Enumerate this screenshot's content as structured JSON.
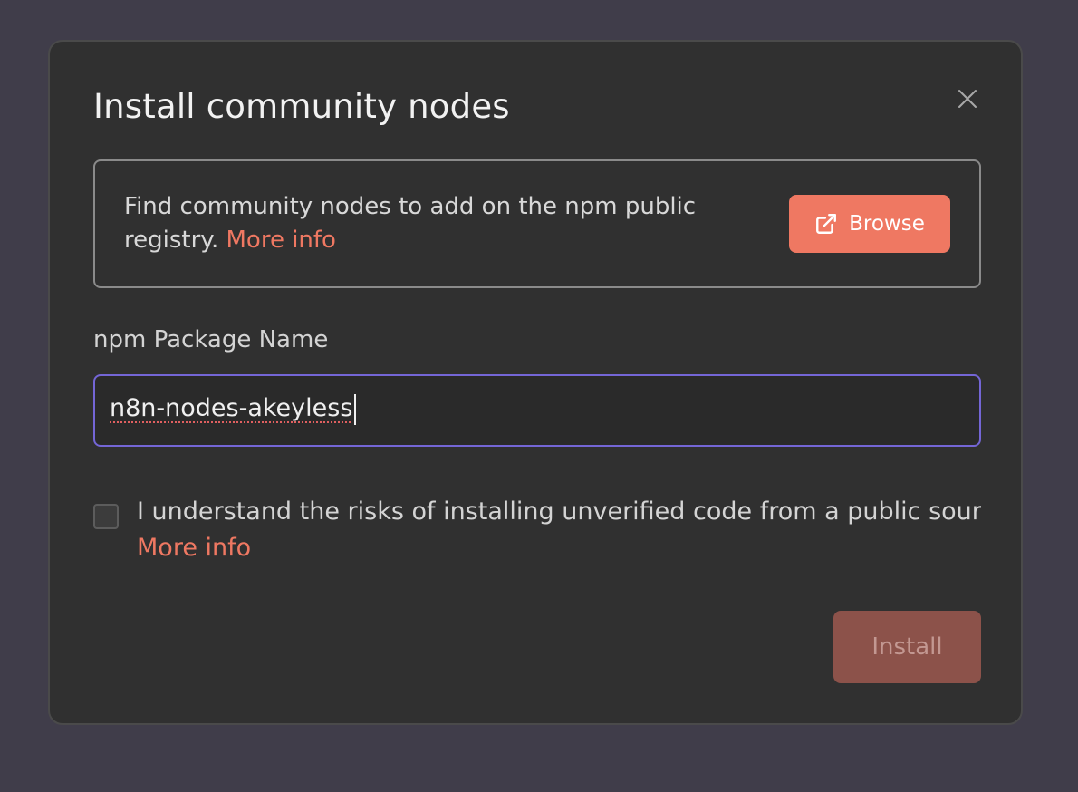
{
  "dialog": {
    "title": "Install community nodes",
    "close_icon": "close-icon"
  },
  "info": {
    "text": "Find community nodes to add on the npm public registry.",
    "more_info_label": "More info",
    "browse_label": "Browse",
    "browse_icon": "external-link-icon"
  },
  "package_field": {
    "label": "npm Package Name",
    "value": "n8n-nodes-akeyless"
  },
  "risk_checkbox": {
    "checked": false,
    "label": "I understand the risks of installing unverified code from a public source.",
    "more_info_label": "More info"
  },
  "install_button": {
    "label": "Install",
    "disabled": true
  },
  "colors": {
    "accent": "#ef7862",
    "focus_border": "#7466d6",
    "modal_bg": "#303030",
    "backdrop": "#403d4a",
    "install_disabled": "#8c524a"
  }
}
